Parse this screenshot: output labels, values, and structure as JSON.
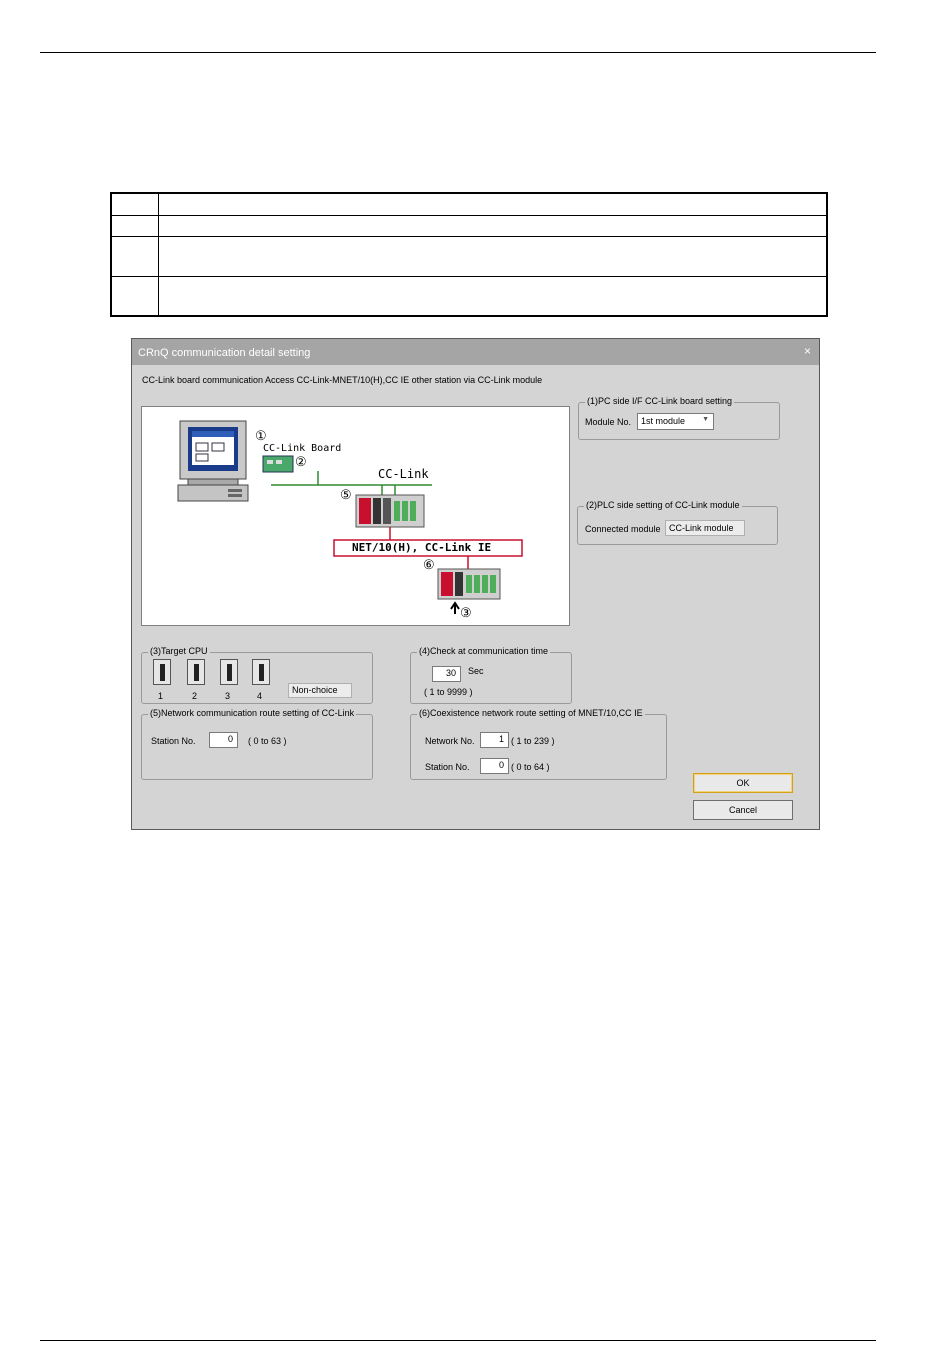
{
  "dialog": {
    "title": "CRnQ communication detail setting",
    "close_glyph": "×",
    "description": "CC-Link board communication Access CC-Link-MNET/10(H),CC IE other station via CC-Link module"
  },
  "diagram": {
    "marker_1": "①",
    "marker_2": "②",
    "marker_3": "③",
    "marker_5": "⑤",
    "marker_6": "⑥",
    "board_label": "CC-Link Board",
    "bus_label": "CC-Link",
    "network_label": "NET/10(H), CC-Link IE"
  },
  "pc_side": {
    "title": "(1)PC side I/F CC-Link board setting",
    "module_no_label": "Module No.",
    "module_no_value": "1st module"
  },
  "plc_side": {
    "title": "(2)PLC side setting of CC-Link module",
    "connected_label": "Connected module",
    "connected_value": "CC-Link module"
  },
  "target_cpu": {
    "title": "(3)Target CPU",
    "cpus": [
      "1",
      "2",
      "3",
      "4"
    ],
    "selection": "Non-choice"
  },
  "check_time": {
    "title": "(4)Check at communication time",
    "value": "30",
    "unit": "Sec",
    "range": "( 1 to 9999 )"
  },
  "route": {
    "title": "(5)Network communication route setting of CC-Link",
    "station_label": "Station No.",
    "station_value": "0",
    "range": "( 0 to 63 )"
  },
  "coexistence": {
    "title": "(6)Coexistence network route setting of MNET/10,CC IE",
    "network_label": "Network No.",
    "network_value": "1",
    "network_range": "( 1 to 239 )",
    "station_label": "Station No.",
    "station_value": "0",
    "station_range": "( 0 to 64 )"
  },
  "buttons": {
    "ok": "OK",
    "cancel": "Cancel"
  }
}
